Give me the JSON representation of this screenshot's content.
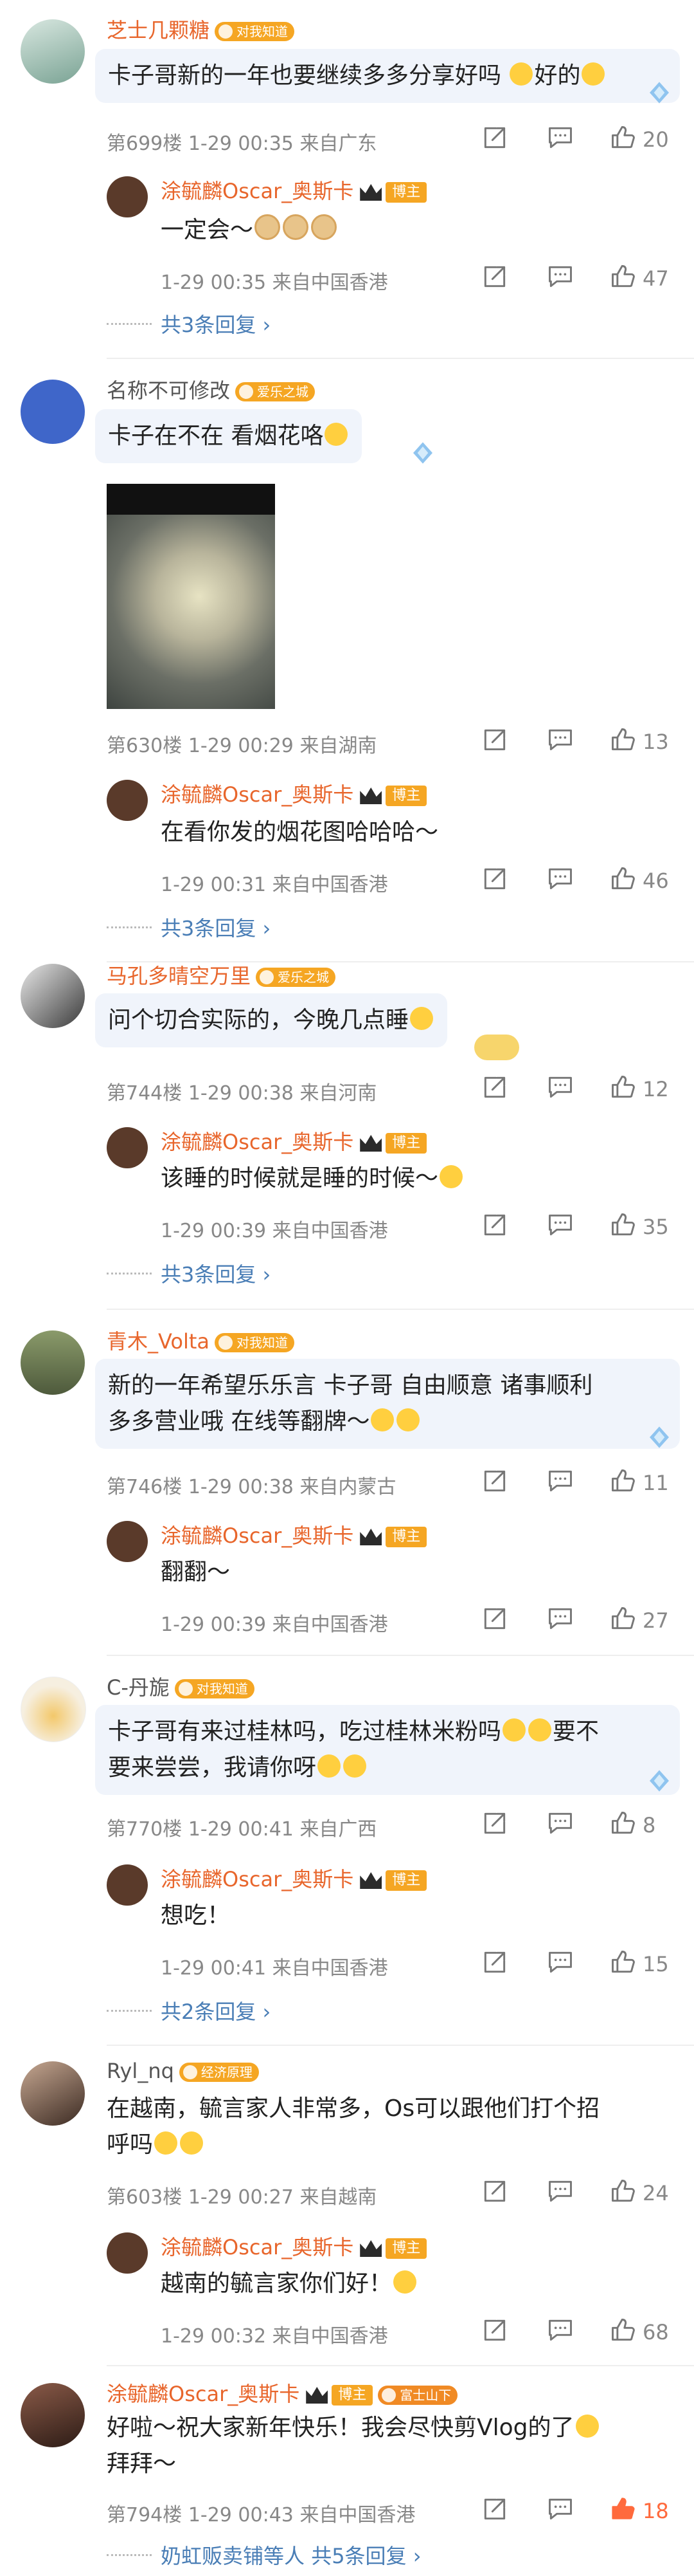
{
  "comments": [
    {
      "name": "芝士几颗糖",
      "badge": "对我知道",
      "text": "卡子哥新的一年也要继续多多分享好吗",
      "text_suffix": "好的",
      "floor": "第699楼",
      "time": "1-29 00:35",
      "location": "来自广东",
      "likes": "20",
      "reply": {
        "name": "涂毓麟Oscar_奥斯卡",
        "role": "博主",
        "text": "一定会～",
        "time": "1-29 00:35",
        "location": "来自中国香港",
        "likes": "47"
      },
      "more": "共3条回复 ›"
    },
    {
      "name": "名称不可修改",
      "badge": "爱乐之城",
      "text": "卡子在不在  看烟花咯",
      "floor": "第630楼",
      "time": "1-29 00:29",
      "location": "来自湖南",
      "likes": "13",
      "reply": {
        "name": "涂毓麟Oscar_奥斯卡",
        "role": "博主",
        "text": "在看你发的烟花图哈哈哈～",
        "time": "1-29 00:31",
        "location": "来自中国香港",
        "likes": "46"
      },
      "more": "共3条回复 ›"
    },
    {
      "name": "马孔多晴空万里",
      "badge": "爱乐之城",
      "text": "问个切合实际的，今晚几点睡",
      "floor": "第744楼",
      "time": "1-29 00:38",
      "location": "来自河南",
      "likes": "12",
      "reply": {
        "name": "涂毓麟Oscar_奥斯卡",
        "role": "博主",
        "text": "该睡的时候就是睡的时候～",
        "time": "1-29 00:39",
        "location": "来自中国香港",
        "likes": "35"
      },
      "more": "共3条回复 ›"
    },
    {
      "name": "青木_Volta",
      "badge": "对我知道",
      "text_line1": "新的一年希望乐乐言 卡子哥 自由顺意 诸事顺利",
      "text_line2": "多多营业哦 在线等翻牌～",
      "floor": "第746楼",
      "time": "1-29 00:38",
      "location": "来自内蒙古",
      "likes": "11",
      "reply": {
        "name": "涂毓麟Oscar_奥斯卡",
        "role": "博主",
        "text": "翻翻～",
        "time": "1-29 00:39",
        "location": "来自中国香港",
        "likes": "27"
      }
    },
    {
      "name": "C-丹旎",
      "badge": "对我知道",
      "text_line1": "卡子哥有来过桂林吗，吃过桂林米粉吗",
      "text_line1_suffix": "要不",
      "text_line2": "要来尝尝，我请你呀",
      "floor": "第770楼",
      "time": "1-29 00:41",
      "location": "来自广西",
      "likes": "8",
      "reply": {
        "name": "涂毓麟Oscar_奥斯卡",
        "role": "博主",
        "text": "想吃！",
        "time": "1-29 00:41",
        "location": "来自中国香港",
        "likes": "15"
      },
      "more": "共2条回复 ›"
    },
    {
      "name": "Ryl_nq",
      "badge": "经济原理",
      "text_line1": "在越南，毓言家人非常多，Os可以跟他们打个招",
      "text_line2": "呼吗",
      "floor": "第603楼",
      "time": "1-29 00:27",
      "location": "来自越南",
      "likes": "24",
      "reply": {
        "name": "涂毓麟Oscar_奥斯卡",
        "role": "博主",
        "text": "越南的毓言家你们好！",
        "time": "1-29 00:32",
        "location": "来自中国香港",
        "likes": "68"
      }
    },
    {
      "name": "涂毓麟Oscar_奥斯卡",
      "role": "博主",
      "badge": "富士山下",
      "text_line1": "好啦～祝大家新年快乐！我会尽快剪Vlog的了",
      "text_line2": "拜拜～",
      "floor": "第794楼",
      "time": "1-29 00:43",
      "location": "来自中国香港",
      "likes": "18",
      "footer_users": "奶虹贩卖铺等人",
      "more": "共5条回复 ›"
    }
  ],
  "colors": {
    "accent": "#e8662c",
    "link": "#4a7eb6",
    "meta": "#888888",
    "bubble": "#f0f4fb",
    "liked": "#ff6a3d"
  },
  "icons": [
    "share-icon",
    "comment-icon",
    "like-icon",
    "diamond-icon",
    "crown-icon"
  ]
}
